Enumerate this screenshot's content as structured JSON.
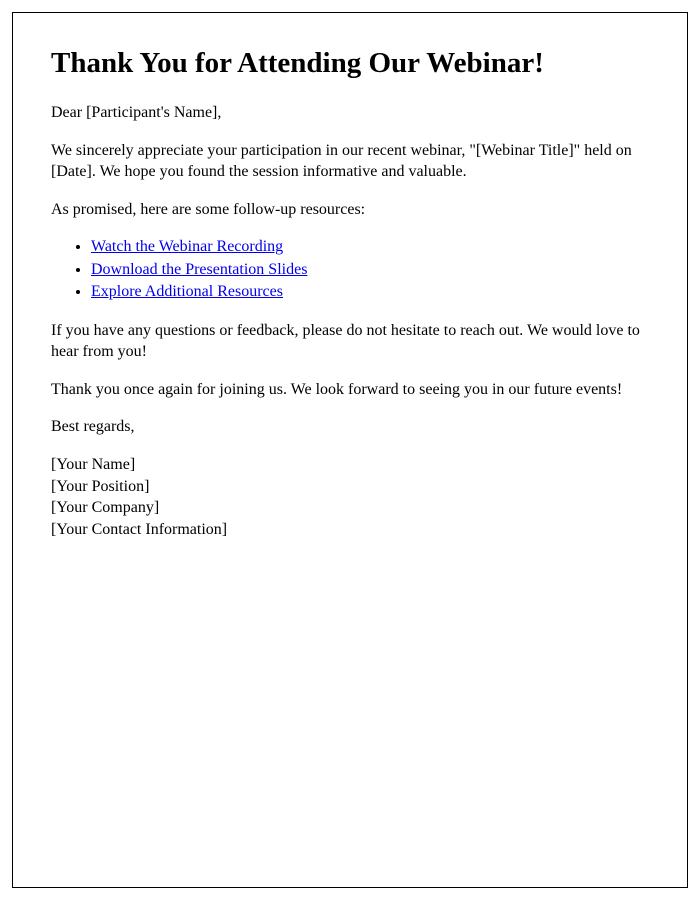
{
  "title": "Thank You for Attending Our Webinar!",
  "greeting": "Dear [Participant's Name],",
  "paragraph1": "We sincerely appreciate your participation in our recent webinar, \"[Webinar Title]\" held on [Date]. We hope you found the session informative and valuable.",
  "paragraph2": "As promised, here are some follow-up resources:",
  "links": [
    "Watch the Webinar Recording",
    "Download the Presentation Slides",
    "Explore Additional Resources"
  ],
  "paragraph3": "If you have any questions or feedback, please do not hesitate to reach out. We would love to hear from you!",
  "paragraph4": "Thank you once again for joining us. We look forward to seeing you in our future events!",
  "closing": "Best regards,",
  "signature": {
    "name": "[Your Name]",
    "position": "[Your Position]",
    "company": "[Your Company]",
    "contact": "[Your Contact Information]"
  }
}
